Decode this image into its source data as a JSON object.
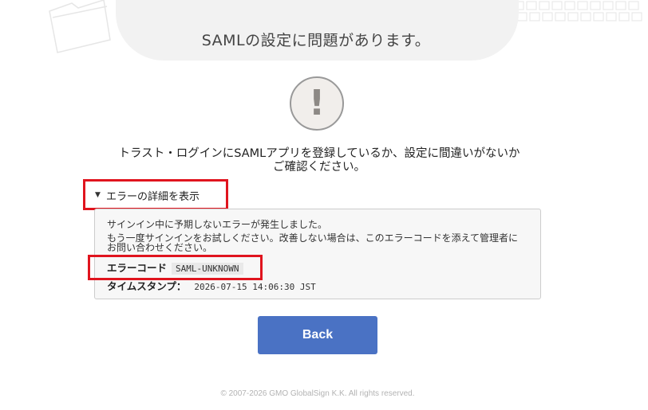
{
  "page": {
    "title": "SAMLの設定に問題があります。",
    "warning_icon_glyph": "!",
    "message_line1": "トラスト・ログインにSAMLアプリを登録しているか、設定に間違いがないか",
    "message_line2": "ご確認ください。"
  },
  "details": {
    "toggle_label": "エラーの詳細を表示",
    "expanded": true,
    "line1": "サインイン中に予期しないエラーが発生しました。",
    "line2": "もう一度サインインをお試しください。改善しない場合は、このエラーコードを添えて管理者にお問い合わせください。",
    "error_code_label": "エラーコード",
    "error_code_value": "SAML-UNKNOWN",
    "timestamp_label": "タイムスタンプ：",
    "timestamp_value": "2026-07-15 14:06:30 JST"
  },
  "actions": {
    "back_label": "Back"
  },
  "footer": {
    "copyright": "© 2007-2026 GMO GlobalSign K.K. All rights reserved."
  },
  "colors": {
    "primary_button": "#4a72c4",
    "highlight_box": "#e0141e",
    "details_background": "#f7f7f7",
    "header_arc": "#f2f2f2"
  },
  "icons": {
    "warning": "exclamation-circle-icon",
    "toggle": "triangle-down-icon",
    "background_left": "folder-icon",
    "background_right": "keyboard-icon"
  }
}
